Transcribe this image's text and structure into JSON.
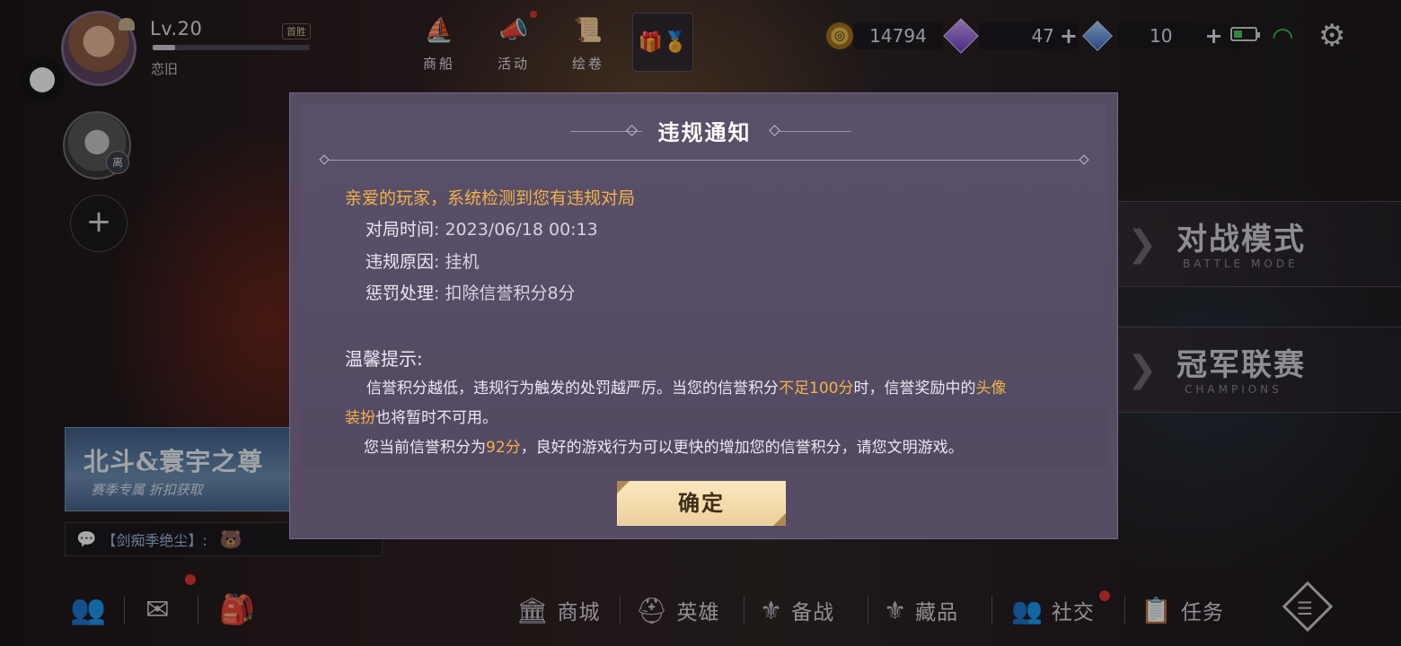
{
  "profile": {
    "level": "Lv.20",
    "xp_progress": 0.14,
    "tag": "首胜",
    "username": "恋旧",
    "friend_status": "离"
  },
  "topnav": [
    {
      "label": "商船",
      "icon": "ship-icon"
    },
    {
      "label": "活动",
      "icon": "megaphone-icon"
    },
    {
      "label": "绘卷",
      "icon": "scroll-icon"
    }
  ],
  "currency": {
    "gold": "14794",
    "purple_gem": "47",
    "blue_gem": "10",
    "plus": "+"
  },
  "modes": [
    {
      "title": "对战模式",
      "subtitle": "BATTLE MODE"
    },
    {
      "title": "冠军联赛",
      "subtitle": "CHAMPIONS"
    }
  ],
  "promo": {
    "title": "北斗&寰宇之尊",
    "subtitle": "赛季专属  折扣获取"
  },
  "chat": {
    "text": "【剑痴季绝尘】:"
  },
  "bottom_nav": [
    {
      "label": "商城",
      "icon": "shop-icon"
    },
    {
      "label": "英雄",
      "icon": "hero-icon"
    },
    {
      "label": "备战",
      "icon": "prepare-icon"
    },
    {
      "label": "藏品",
      "icon": "collection-icon"
    },
    {
      "label": "社交",
      "icon": "social-icon"
    },
    {
      "label": "任务",
      "icon": "task-icon"
    }
  ],
  "dialog": {
    "title": "违规通知",
    "greeting": "亲爱的玩家，系统检测到您有违规对局",
    "match_time_label": "对局时间",
    "match_time_value": ": 2023/06/18 00:13",
    "reason_label": "违规原因",
    "reason_value": ": 挂机",
    "penalty_label": "惩罚处理",
    "penalty_value": ": 扣除信誉积分8分",
    "tip_title": "温馨提示:",
    "tip1_a": "信誉积分越低，违规行为触发的处罚越严厉。当您的信誉积分",
    "tip1_b": "不足100分",
    "tip1_c": "时，信誉奖励中的",
    "tip1_d": "头像",
    "tip1_e": "装扮",
    "tip1_f": "也将暂时不可用。",
    "tip2_a": "您当前信誉积分为",
    "tip2_b": "92分",
    "tip2_c": "，良好的游戏行为可以更快的增加您的信誉积分，请您文明游戏。",
    "confirm": "确定"
  },
  "colors": {
    "highlight": "#f2b24a",
    "dialog_bg": "#564d64",
    "confirm_bg": "#f3dcaa"
  }
}
